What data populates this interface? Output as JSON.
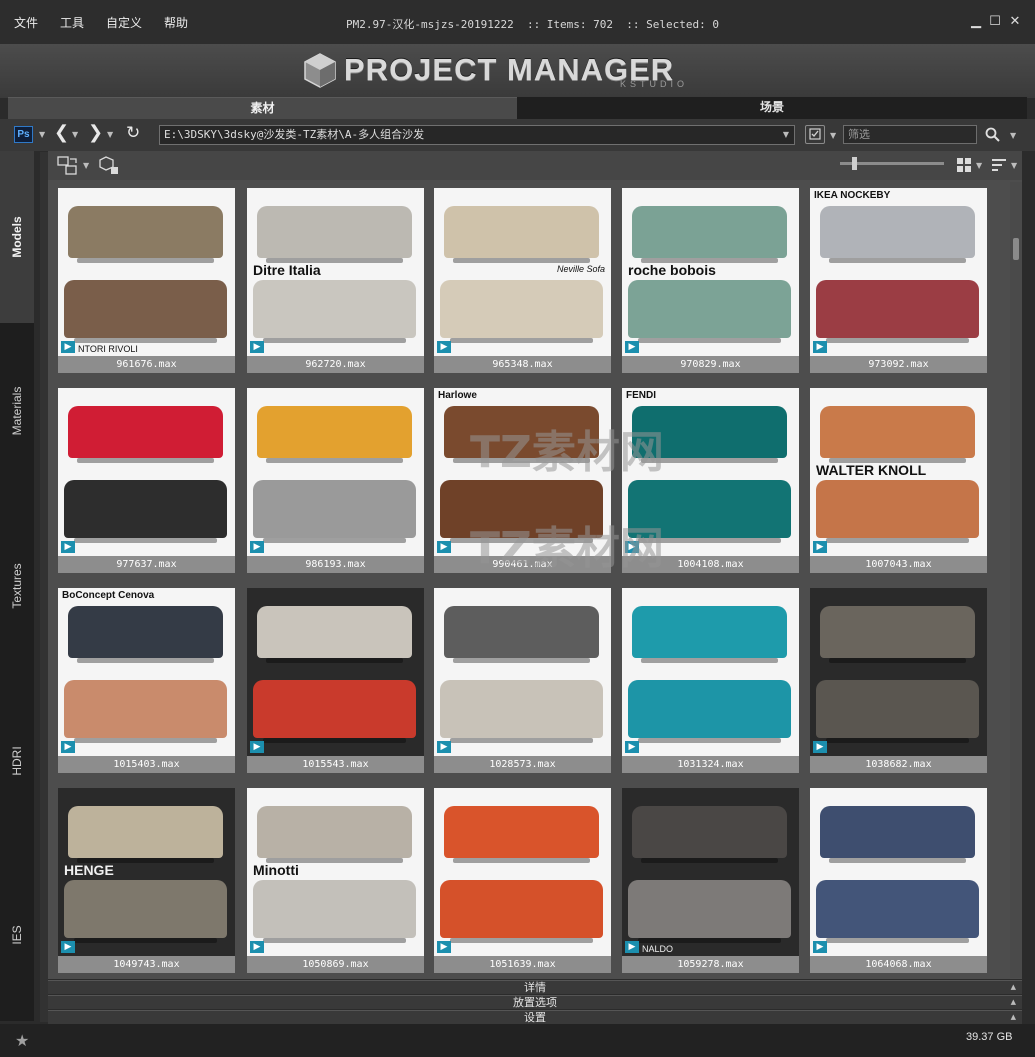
{
  "menu": [
    "文件",
    "工具",
    "自定义",
    "帮助"
  ],
  "window": {
    "title": "PM2.97-汉化-msjzs-20191222  :: Items: 702  :: Selected: 0",
    "minimize": "▁",
    "maximize": "☐",
    "close": "✕"
  },
  "logo": {
    "text": "PROJECT MANAGER",
    "subtext": "KSTUDIO"
  },
  "tabs": {
    "assets": "素材",
    "scene": "场景"
  },
  "toolbar": {
    "ps_label": "Ps",
    "path": "E:\\3DSKY\\3dsky@沙发类-TZ素材\\A-多人组合沙发",
    "filter_placeholder": "筛选"
  },
  "side_tabs": [
    "Models",
    "Materials",
    "Textures",
    "HDRI",
    "IES"
  ],
  "items": [
    {
      "name": "961676.max",
      "colors": [
        "#8b7b63",
        "#7a5e4a"
      ],
      "brand": "NTORI RIVOLI",
      "brand_pos": "bottom"
    },
    {
      "name": "962720.max",
      "colors": [
        "#bcb9b2",
        "#c9c6bf"
      ],
      "brand": "Ditre Italia",
      "brand_pos": "mid"
    },
    {
      "name": "965348.max",
      "colors": [
        "#cfc2aa",
        "#d5cbb8"
      ],
      "brand": "Neville Sofa",
      "brand_pos": "mid-right"
    },
    {
      "name": "970829.max",
      "colors": [
        "#7ba295",
        "#7ca396"
      ],
      "brand": "roche bobois",
      "brand_pos": "mid"
    },
    {
      "name": "973092.max",
      "colors": [
        "#b0b3b8",
        "#9b3d44"
      ],
      "brand": "IKEA NOCKEBY",
      "brand_pos": "top"
    },
    {
      "name": "977637.max",
      "colors": [
        "#d01d34",
        "#2d2d2d"
      ],
      "brand": "",
      "brand_pos": ""
    },
    {
      "name": "986193.max",
      "colors": [
        "#e3a12f",
        "#9a9a9a"
      ],
      "brand": "",
      "brand_pos": ""
    },
    {
      "name": "990461.max",
      "colors": [
        "#7a4a2e",
        "#6f4128"
      ],
      "brand": "Harlowe",
      "brand_pos": "top"
    },
    {
      "name": "1004108.max",
      "colors": [
        "#0f6e6e",
        "#127474"
      ],
      "brand": "FENDI",
      "brand_pos": "top"
    },
    {
      "name": "1007043.max",
      "colors": [
        "#c97a4a",
        "#c57549"
      ],
      "brand": "WALTER KNOLL",
      "brand_pos": "mid"
    },
    {
      "name": "1015403.max",
      "colors": [
        "#343b46",
        "#c98b6c"
      ],
      "brand": "BoConcept Cenova",
      "brand_pos": "top"
    },
    {
      "name": "1015543.max",
      "colors": [
        "#c9c4bb",
        "#c93a2c"
      ],
      "brand": "",
      "brand_pos": ""
    },
    {
      "name": "1028573.max",
      "colors": [
        "#5d5d5d",
        "#c8c2b8"
      ],
      "brand": "",
      "brand_pos": ""
    },
    {
      "name": "1031324.max",
      "colors": [
        "#1e9bab",
        "#1d95a7"
      ],
      "brand": "",
      "brand_pos": ""
    },
    {
      "name": "1038682.max",
      "colors": [
        "#6a655d",
        "#5a5650"
      ],
      "brand": "",
      "brand_pos": ""
    },
    {
      "name": "1049743.max",
      "colors": [
        "#bdb29b",
        "#7e786c"
      ],
      "brand": "HENGE",
      "brand_pos": "mid"
    },
    {
      "name": "1050869.max",
      "colors": [
        "#b8b1a6",
        "#c3c0ba"
      ],
      "brand": "Minotti",
      "brand_pos": "mid"
    },
    {
      "name": "1051639.max",
      "colors": [
        "#d9542b",
        "#d5512a"
      ],
      "brand": "",
      "brand_pos": ""
    },
    {
      "name": "1059278.max",
      "colors": [
        "#4a4745",
        "#7d7a78"
      ],
      "brand": "NALDO",
      "brand_pos": "bottom"
    },
    {
      "name": "1064068.max",
      "colors": [
        "#3e4e6f",
        "#435579"
      ],
      "brand": "",
      "brand_pos": ""
    }
  ],
  "dark_thumbs": [
    "1015543.max",
    "1038682.max",
    "1049743.max",
    "1059278.max"
  ],
  "rollouts": [
    "详情",
    "放置选项",
    "设置"
  ],
  "status": {
    "disk": "39.37 GB"
  },
  "watermark": {
    "line1": "TZ素材网",
    "line2": "TZ素材网"
  },
  "accent": "#1c8fae"
}
